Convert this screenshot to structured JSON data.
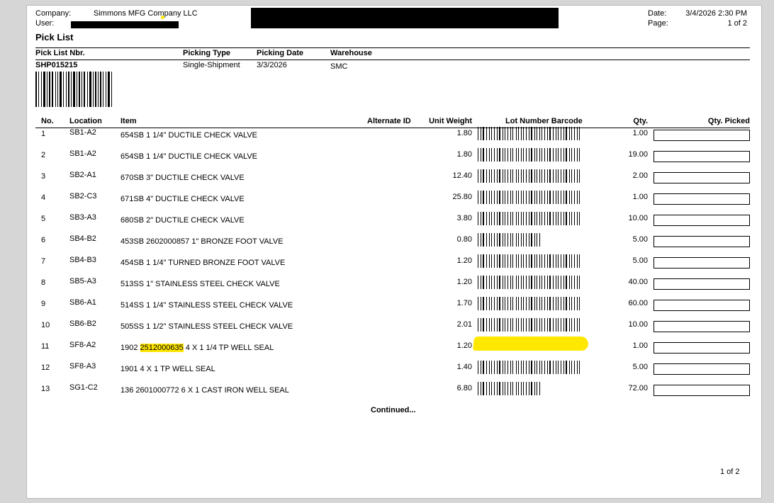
{
  "header": {
    "company_label": "Company:",
    "company": "Simmons MFG Company LLC",
    "user_label": "User:",
    "date_label": "Date:",
    "date": "3/4/2026 2:30 PM",
    "page_label": "Page:",
    "page": "1 of 2",
    "title": "Pick List"
  },
  "pick_info": {
    "labels": [
      "Pick List Nbr.",
      "Picking Type",
      "Picking Date",
      "Warehouse"
    ],
    "pick_list_nbr": "SHP015215",
    "picking_type": "Single-Shipment",
    "picking_date": "3/3/2026",
    "warehouse": "SMC"
  },
  "table": {
    "headers": [
      "No.",
      "Location",
      "Item",
      "Alternate ID",
      "Unit Weight",
      "Lot Number Barcode",
      "Qty.",
      "Qty. Picked"
    ],
    "rows": [
      {
        "no": "1",
        "location": "SB1-A2",
        "item": "654SB  1 1/4\" DUCTILE CHECK VALVE",
        "weight": "1.80",
        "qty": "1.00",
        "barcode": "long"
      },
      {
        "no": "2",
        "location": "SB1-A2",
        "item": "654SB  1 1/4\" DUCTILE CHECK VALVE",
        "weight": "1.80",
        "qty": "19.00",
        "barcode": "long"
      },
      {
        "no": "3",
        "location": "SB2-A1",
        "item": "670SB  3\" DUCTILE CHECK VALVE",
        "weight": "12.40",
        "qty": "2.00",
        "barcode": "long"
      },
      {
        "no": "4",
        "location": "SB2-C3",
        "item": "671SB  4\" DUCTILE CHECK VALVE",
        "weight": "25.80",
        "qty": "1.00",
        "barcode": "long"
      },
      {
        "no": "5",
        "location": "SB3-A3",
        "item": "680SB  2\" DUCTILE CHECK VALVE",
        "weight": "3.80",
        "qty": "10.00",
        "barcode": "long"
      },
      {
        "no": "6",
        "location": "SB4-B2",
        "item": "453SB 2602000857 1\" BRONZE FOOT VALVE",
        "weight": "0.80",
        "qty": "5.00",
        "barcode": "short"
      },
      {
        "no": "7",
        "location": "SB4-B3",
        "item": "454SB  1 1/4\" TURNED BRONZE FOOT VALVE",
        "weight": "1.20",
        "qty": "5.00",
        "barcode": "long"
      },
      {
        "no": "8",
        "location": "SB5-A3",
        "item": "513SS  1\" STAINLESS STEEL CHECK VALVE",
        "weight": "1.20",
        "qty": "40.00",
        "barcode": "long"
      },
      {
        "no": "9",
        "location": "SB6-A1",
        "item": "514SS  1 1/4\" STAINLESS STEEL CHECK VALVE",
        "weight": "1.70",
        "qty": "60.00",
        "barcode": "long"
      },
      {
        "no": "10",
        "location": "SB6-B2",
        "item": "505SS  1 1/2\" STAINLESS STEEL CHECK VALVE",
        "weight": "2.01",
        "qty": "10.00",
        "barcode": "long"
      },
      {
        "no": "11",
        "location": "SF8-A2",
        "item_pre": "1902 ",
        "item_hl": "2512000635",
        "item_post": " 4 X 1 1/4 TP WELL SEAL",
        "weight": "1.20",
        "qty": "1.00",
        "barcode": "highlighted"
      },
      {
        "no": "12",
        "location": "SF8-A3",
        "item": "1901  4 X 1 TP WELL SEAL",
        "weight": "1.40",
        "qty": "5.00",
        "barcode": "long"
      },
      {
        "no": "13",
        "location": "SG1-C2",
        "item": "136 2601000772 6 X 1 CAST IRON WELL SEAL",
        "weight": "6.80",
        "qty": "72.00",
        "barcode": "short"
      }
    ]
  },
  "continued": "Continued...",
  "footer_page": "1 of 2",
  "colors": {
    "highlight": "#ffe600",
    "background": "#d6d6d6"
  }
}
